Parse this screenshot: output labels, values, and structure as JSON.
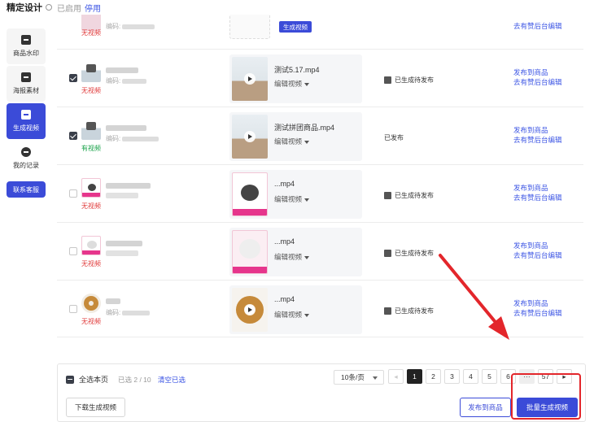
{
  "topbar": {
    "title": "精定设计",
    "status": "已启用",
    "disable_link": "停用"
  },
  "sidebar": {
    "items": [
      {
        "label": "商品水印",
        "icon": "watermark-icon"
      },
      {
        "label": "海报素材",
        "icon": "image-icon"
      },
      {
        "label": "生成视频",
        "icon": "video-icon"
      },
      {
        "label": "我的记录",
        "icon": "record-icon"
      }
    ],
    "contact": "联系客服"
  },
  "rows": [
    {
      "checked": false,
      "tag": "无视频",
      "tag_color": "red",
      "code_label": "编码:",
      "video": null,
      "generate_label": "生成视频",
      "publish": "",
      "actions": [
        "去有赞后台编辑"
      ]
    },
    {
      "checked": true,
      "tag": "无视频",
      "tag_color": "red",
      "code_label": "编码:",
      "video": "测试5.17.mp4",
      "edit": "编辑视频",
      "publish": "已生成待发布",
      "actions": [
        "发布到商品",
        "去有赞后台编辑"
      ]
    },
    {
      "checked": true,
      "tag": "有视频",
      "tag_color": "green",
      "code_label": "编码:",
      "video": "测试拼团商品.mp4",
      "edit": "编辑视频",
      "publish": "已发布",
      "actions": [
        "发布到商品",
        "去有赞后台编辑"
      ]
    },
    {
      "checked": false,
      "tag": "无视频",
      "tag_color": "red",
      "code_label": "",
      "video": "...mp4",
      "edit": "编辑视频",
      "publish": "已生成待发布",
      "actions": [
        "发布到商品",
        "去有赞后台编辑"
      ]
    },
    {
      "checked": false,
      "tag": "无视频",
      "tag_color": "red",
      "code_label": "",
      "video": "...mp4",
      "edit": "编辑视频",
      "publish": "已生成待发布",
      "actions": [
        "发布到商品",
        "去有赞后台编辑"
      ]
    },
    {
      "checked": false,
      "tag": "无视频",
      "tag_color": "red",
      "code_label": "编码:",
      "video": "...mp4",
      "edit": "编辑视频",
      "publish": "已生成待发布",
      "actions": [
        "发布到商品",
        "去有赞后台编辑"
      ]
    }
  ],
  "footer": {
    "select_all": "全选本页",
    "selected_count": "已选 2 / 10",
    "clear": "清空已选",
    "page_size": "10条/页",
    "pages": [
      "1",
      "2",
      "3",
      "4",
      "5",
      "6",
      "···",
      "57"
    ],
    "download": "下载生成视频",
    "publish": "发布到商品",
    "batch_generate": "批量生成视频"
  },
  "colors": {
    "accent": "#3b4bd8",
    "link": "#3b54e4",
    "no_video": "#e03b3b",
    "has_video": "#1aa34a",
    "annotation": "#e3262b"
  }
}
